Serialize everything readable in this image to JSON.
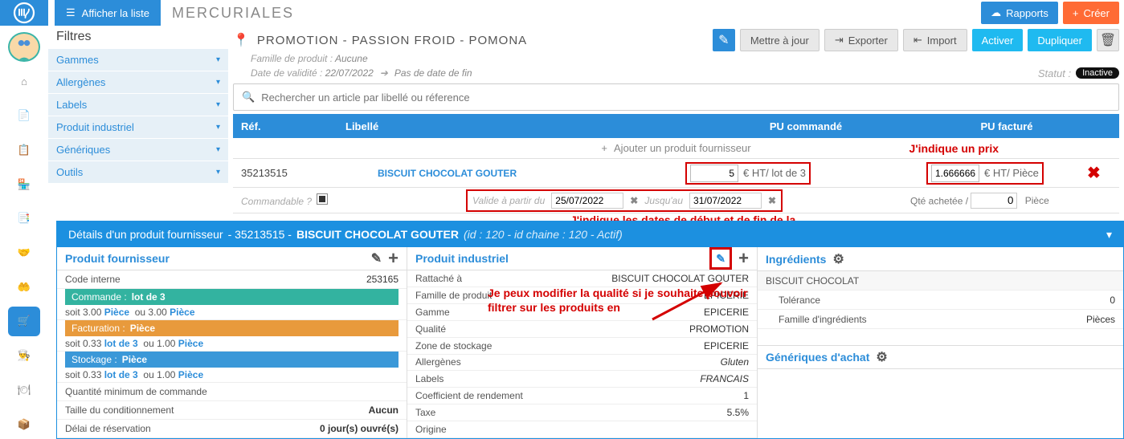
{
  "header": {
    "show_list_label": "Afficher la liste",
    "module_title": "MERCURIALES",
    "reports_label": "Rapports",
    "create_label": "Créer"
  },
  "filters": {
    "title": "Filtres",
    "items": [
      "Gammes",
      "Allergènes",
      "Labels",
      "Produit industriel",
      "Génériques",
      "Outils"
    ]
  },
  "promo": {
    "title": "PROMOTION - PASSION FROID - POMONA",
    "family_label": "Famille de produit :",
    "family_value": "Aucune",
    "validity_label": "Date de validité :",
    "validity_value": "22/07/2022",
    "validity_end": "Pas de date de fin",
    "update_label": "Mettre à jour",
    "export_label": "Exporter",
    "import_label": "Import",
    "activate_label": "Activer",
    "duplicate_label": "Dupliquer",
    "status_label": "Statut :",
    "status_value": "Inactive"
  },
  "search": {
    "placeholder": "Rechercher un article par libellé ou réference"
  },
  "table": {
    "col_ref": "Réf.",
    "col_lib": "Libellé",
    "col_pu_cmd": "PU commandé",
    "col_pu_fact": "PU facturé",
    "add_label": "Ajouter un produit fournisseur",
    "row": {
      "ref": "35213515",
      "libelle": "BISCUIT CHOCOLAT GOUTER",
      "pu_cmd_value": "5",
      "pu_cmd_unit": "€ HT/ lot de 3",
      "pu_fact_value": "1.666666",
      "pu_fact_unit": "€ HT/ Pièce"
    },
    "row2": {
      "commandable": "Commandable ?",
      "valid_from_label": "Valide à partir du",
      "valid_from": "25/07/2022",
      "until_label": "Jusqu'au",
      "until": "31/07/2022",
      "qty_label": "Qté achetée /",
      "qty_value": "0",
      "qty_unit": "Pièce"
    }
  },
  "annotations": {
    "price": "J'indique un prix",
    "dates": "J'indique les dates de début et de fin de la",
    "quality": "Je peux modifier la qualité si je souhaite pouvoir filtrer sur les produits en"
  },
  "detail": {
    "title_prefix": "Détails d'un produit fournisseur",
    "title_ref": "- 35213515 -",
    "title_name": "BISCUIT CHOCOLAT GOUTER",
    "title_meta": "(id : 120 - id chaine : 120 - Actif)",
    "col1": {
      "title": "Produit fournisseur",
      "code_interne": "Code interne",
      "code_interne_val": "253165",
      "commande_label": "Commande :",
      "commande_val": "lot de 3",
      "commande_sub_a": "soit 3.00",
      "commande_sub_b": "ou 3.00",
      "piece": "Pièce",
      "facturation_label": "Facturation :",
      "facturation_val": "Pièce",
      "fact_sub_a": "soit 0.33",
      "lot3": "lot de 3",
      "fact_sub_b": "ou 1.00",
      "stockage_label": "Stockage :",
      "stockage_val": "Pièce",
      "stock_sub_a": "soit 0.33",
      "stock_sub_b": "ou 1.00",
      "qmin_label": "Quantité minimum de commande",
      "taille_label": "Taille du conditionnement",
      "taille_val": "Aucun",
      "delai_label": "Délai de réservation",
      "delai_val": "0 jour(s) ouvré(s)"
    },
    "col2": {
      "title": "Produit industriel",
      "rattache": "Rattaché à",
      "rattache_val": "BISCUIT CHOCOLAT GOUTER",
      "famille": "Famille de produit",
      "famille_val": "EPICERIE",
      "gamme": "Gamme",
      "gamme_val": "EPICERIE",
      "qualite": "Qualité",
      "qualite_val": "PROMOTION",
      "zone": "Zone de stockage",
      "zone_val": "EPICERIE",
      "allerg": "Allergènes",
      "allerg_val": "Gluten",
      "labels": "Labels",
      "labels_val": "FRANCAIS",
      "coef": "Coefficient de rendement",
      "coef_val": "1",
      "taxe": "Taxe",
      "taxe_val": "5.5%",
      "origine": "Origine"
    },
    "col3": {
      "ing_title": "Ingrédients",
      "ing_name": "BISCUIT CHOCOLAT",
      "tol": "Tolérance",
      "tol_val": "0",
      "faming": "Famille d'ingrédients",
      "faming_val": "Pièces",
      "gen_title": "Génériques d'achat"
    }
  }
}
